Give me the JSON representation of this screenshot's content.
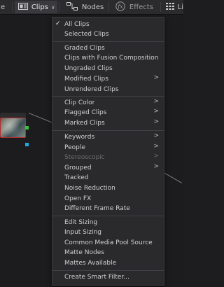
{
  "toolbar": {
    "partial_item_label": "e",
    "clips_label": "Clips",
    "nodes_label": "Nodes",
    "effects_label": "Effects",
    "trailing_label": "Li"
  },
  "menu": {
    "items": [
      {
        "label": "All Clips",
        "checked": true,
        "submenu": false,
        "disabled": false
      },
      {
        "label": "Selected Clips",
        "checked": false,
        "submenu": false,
        "disabled": false
      },
      {
        "label": "Graded Clips",
        "checked": false,
        "submenu": false,
        "disabled": false
      },
      {
        "label": "Clips with Fusion Composition",
        "checked": false,
        "submenu": false,
        "disabled": false
      },
      {
        "label": "Ungraded Clips",
        "checked": false,
        "submenu": false,
        "disabled": false
      },
      {
        "label": "Modified Clips",
        "checked": false,
        "submenu": true,
        "disabled": false
      },
      {
        "label": "Unrendered Clips",
        "checked": false,
        "submenu": false,
        "disabled": false
      },
      {
        "label": "Clip Color",
        "checked": false,
        "submenu": true,
        "disabled": false
      },
      {
        "label": "Flagged Clips",
        "checked": false,
        "submenu": true,
        "disabled": false
      },
      {
        "label": "Marked Clips",
        "checked": false,
        "submenu": true,
        "disabled": false
      },
      {
        "label": "Keywords",
        "checked": false,
        "submenu": true,
        "disabled": false
      },
      {
        "label": "People",
        "checked": false,
        "submenu": true,
        "disabled": false
      },
      {
        "label": "Stereoscopic",
        "checked": false,
        "submenu": true,
        "disabled": true
      },
      {
        "label": "Grouped",
        "checked": false,
        "submenu": true,
        "disabled": false
      },
      {
        "label": "Tracked",
        "checked": false,
        "submenu": false,
        "disabled": false
      },
      {
        "label": "Noise Reduction",
        "checked": false,
        "submenu": false,
        "disabled": false
      },
      {
        "label": "Open FX",
        "checked": false,
        "submenu": false,
        "disabled": false
      },
      {
        "label": "Different Frame Rate",
        "checked": false,
        "submenu": false,
        "disabled": false
      },
      {
        "label": "Edit Sizing",
        "checked": false,
        "submenu": false,
        "disabled": false
      },
      {
        "label": "Input Sizing",
        "checked": false,
        "submenu": false,
        "disabled": false
      },
      {
        "label": "Common Media Pool Source",
        "checked": false,
        "submenu": false,
        "disabled": false
      },
      {
        "label": "Matte Nodes",
        "checked": false,
        "submenu": false,
        "disabled": false
      },
      {
        "label": "Mattes Available",
        "checked": false,
        "submenu": false,
        "disabled": false
      },
      {
        "label": "Create Smart Filter...",
        "checked": false,
        "submenu": false,
        "disabled": false
      }
    ]
  },
  "icons": {
    "clips": "clips-icon",
    "nodes": "nodes-icon",
    "effects": "fx-icon",
    "lightbox": "grid-icon"
  },
  "colors": {
    "node_border": "#b52b2b",
    "output_port_green": "#39c339",
    "output_port_blue": "#27a7e0",
    "menu_background": "#2a2a2d"
  }
}
